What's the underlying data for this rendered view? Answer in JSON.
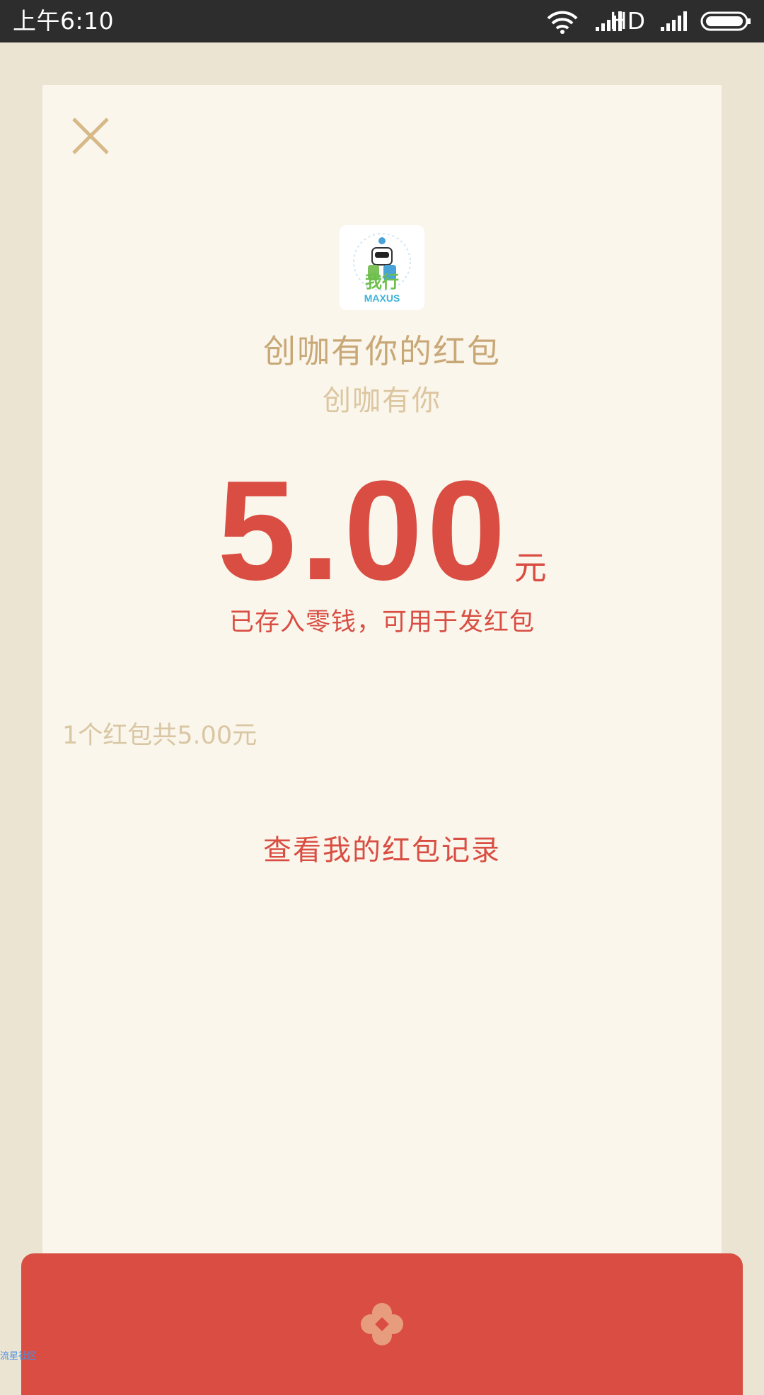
{
  "status_bar": {
    "time": "上午6:10",
    "network_label": "HD",
    "icons": [
      "wifi-icon",
      "signal-icon",
      "signal-icon",
      "battery-icon"
    ]
  },
  "card": {
    "close_icon": "close-icon",
    "avatar_icon": "maxus-logo",
    "title": "创咖有你的红包",
    "subtitle": "创咖有你",
    "amount": "5.00",
    "amount_unit": "元",
    "stored_note": "已存入零钱，可用于发红包",
    "summary": "1个红包共5.00元",
    "records_link": "查看我的红包记录"
  },
  "colors": {
    "status_bg": "#2d2d2d",
    "page_bg": "#ece4d3",
    "card_bg": "#faf6ec",
    "accent_red": "#d94d42",
    "gold": "#c9a878",
    "light_gold": "#dcc6a0"
  },
  "watermark": "流星社区"
}
